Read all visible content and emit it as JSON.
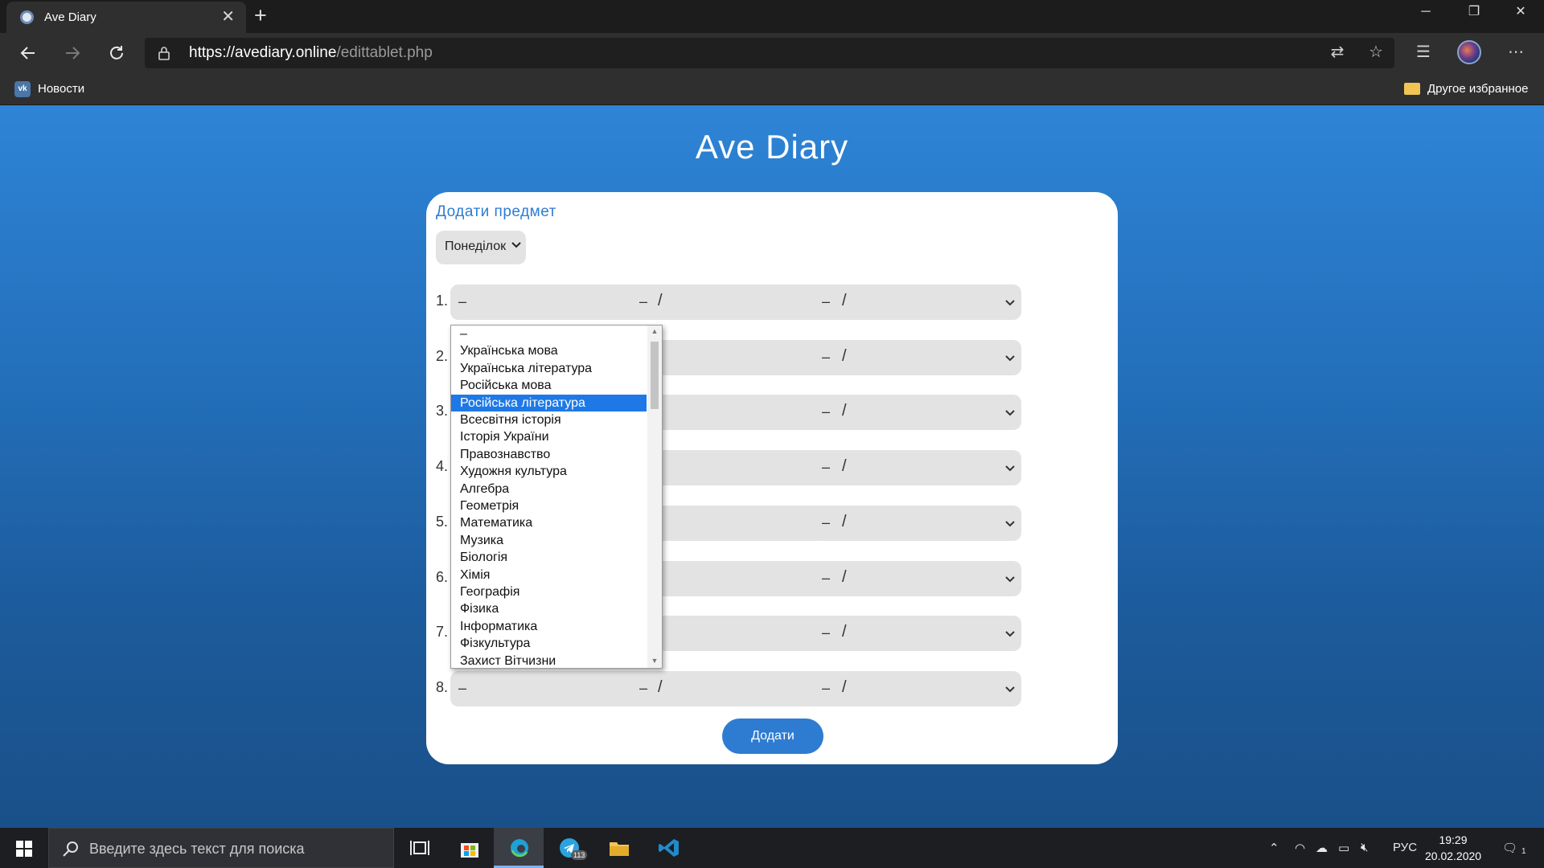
{
  "browser": {
    "tab_title": "Ave Diary",
    "close_glyph": "✕",
    "new_tab_glyph": "+",
    "url_scheme": "https://",
    "url_host": "avediary.online",
    "url_path": "/edittablet.php",
    "bookmarks": [
      {
        "label": "Новости",
        "icon": "vk-icon"
      }
    ],
    "other_bookmarks_label": "Другое избранное",
    "window_controls": [
      "─",
      "❐",
      "✕"
    ]
  },
  "page": {
    "site_title": "Ave Diary",
    "card_heading": "Додати предмет",
    "day_select_value": "Понеділок",
    "rows": [
      {
        "number": "1.",
        "values": [
          "–",
          "–",
          "–"
        ]
      },
      {
        "number": "2.",
        "values": [
          "–",
          "–",
          "–"
        ]
      },
      {
        "number": "3.",
        "values": [
          "–",
          "–",
          "–"
        ]
      },
      {
        "number": "4.",
        "values": [
          "–",
          "–",
          "–"
        ]
      },
      {
        "number": "5.",
        "values": [
          "–",
          "–",
          "–"
        ]
      },
      {
        "number": "6.",
        "values": [
          "–",
          "–",
          "–"
        ]
      },
      {
        "number": "7.",
        "values": [
          "–",
          "–",
          "–"
        ]
      },
      {
        "number": "8.",
        "values": [
          "–",
          "–",
          "–"
        ]
      }
    ],
    "separator": "/",
    "submit_label": "Додати"
  },
  "dropdown": {
    "options": [
      "–",
      "Українська мова",
      "Українська література",
      "Російська мова",
      "Російська література",
      "Всесвітня історія",
      "Історія України",
      "Правознавство",
      "Художня культура",
      "Алгебра",
      "Геометрія",
      "Математика",
      "Музика",
      "Біологія",
      "Хімія",
      "Географія",
      "Фізика",
      "Інформатика",
      "Фізкультура",
      "Захист Вітчизни"
    ],
    "highlighted": "Російська література",
    "highlight_color": "#1e79e6"
  },
  "taskbar": {
    "search_placeholder": "Введите здесь текст для поиска",
    "telegram_badge": "113",
    "language": "РУС",
    "time": "19:29",
    "date": "20.02.2020",
    "notifications": "1"
  }
}
